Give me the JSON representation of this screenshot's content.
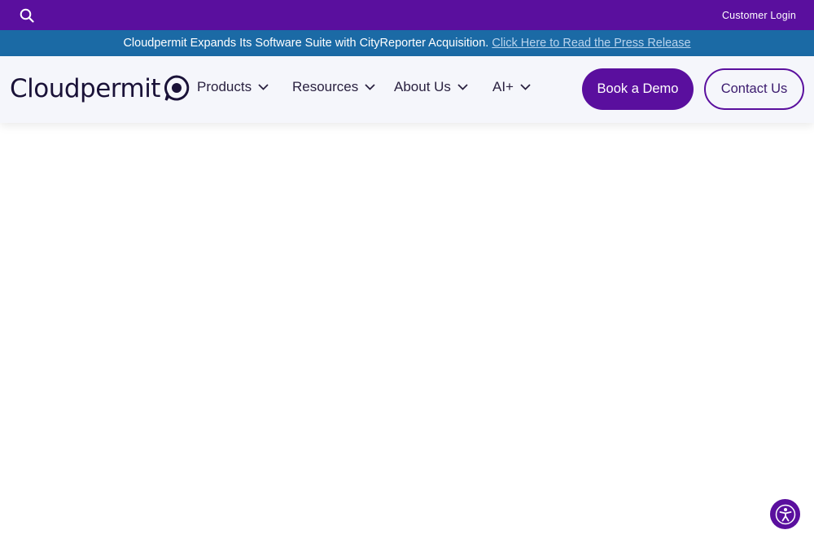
{
  "topbar": {
    "search_icon": "search-icon",
    "customer_login": "Customer Login",
    "bg_color": "#5a0f9e"
  },
  "announcement": {
    "text": "Cloudpermit Expands Its Software Suite with CityReporter Acquisition.",
    "link_text": "Click Here to Read the Press Release",
    "bg_color": "#1b6aa5"
  },
  "header": {
    "logo_text": "Cloudpermit",
    "nav": [
      {
        "label": "Products",
        "icon": "chevron-down-icon"
      },
      {
        "label": "Resources",
        "icon": "chevron-down-icon"
      },
      {
        "label": "About Us",
        "icon": "chevron-down-icon"
      },
      {
        "label": "AI+",
        "icon": "chevron-down-icon"
      }
    ],
    "cta_primary": "Book a Demo",
    "cta_secondary": "Contact Us",
    "accent_color": "#5a0f9e"
  },
  "widgets": {
    "accessibility_icon": "accessibility-icon"
  }
}
